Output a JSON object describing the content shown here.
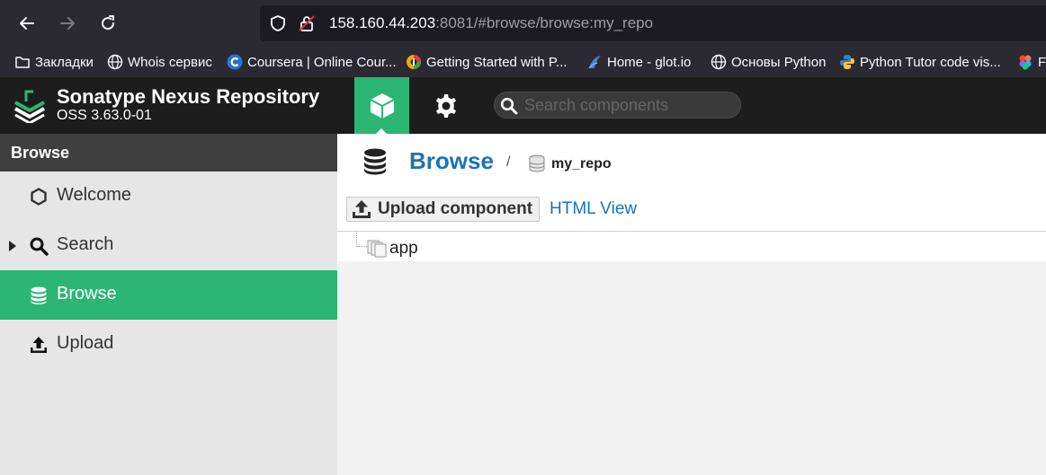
{
  "browser": {
    "url_host": "158.160.44.203",
    "url_rest": ":8081/#browse/browse:my_repo",
    "bookmarks": [
      {
        "label": "Закладки",
        "icon": "folder-icon"
      },
      {
        "label": "Whois сервис",
        "icon": "globe-icon"
      },
      {
        "label": "Coursera | Online Cour...",
        "icon": "coursera-icon"
      },
      {
        "label": "Getting Started with P...",
        "icon": "colorful-circle-icon"
      },
      {
        "label": "Home - glot.io",
        "icon": "glot-icon"
      },
      {
        "label": "Основы Python",
        "icon": "globe-icon"
      },
      {
        "label": "Python Tutor code vis...",
        "icon": "python-icon"
      },
      {
        "label": "F",
        "icon": "figma-icon"
      }
    ]
  },
  "header": {
    "title": "Sonatype Nexus Repository",
    "version": "OSS 3.63.0-01",
    "search_placeholder": "Search components"
  },
  "sidebar": {
    "title": "Browse",
    "items": [
      {
        "label": "Welcome",
        "icon": "hexagon-icon",
        "active": false
      },
      {
        "label": "Search",
        "icon": "search-icon",
        "active": false,
        "expandable": true
      },
      {
        "label": "Browse",
        "icon": "database-icon",
        "active": true
      },
      {
        "label": "Upload",
        "icon": "upload-icon",
        "active": false
      }
    ]
  },
  "main": {
    "breadcrumb_title": "Browse",
    "breadcrumb_sep": "/",
    "repo_name": "my_repo",
    "upload_button": "Upload component",
    "html_view_link": "HTML View",
    "tree": [
      {
        "label": "app",
        "icon": "folder-stack-icon"
      }
    ]
  },
  "colors": {
    "accent": "#2bb673",
    "header_bg": "#1d1d1d",
    "link": "#1a73b7",
    "sidebar_bg": "#e6e6e6"
  }
}
